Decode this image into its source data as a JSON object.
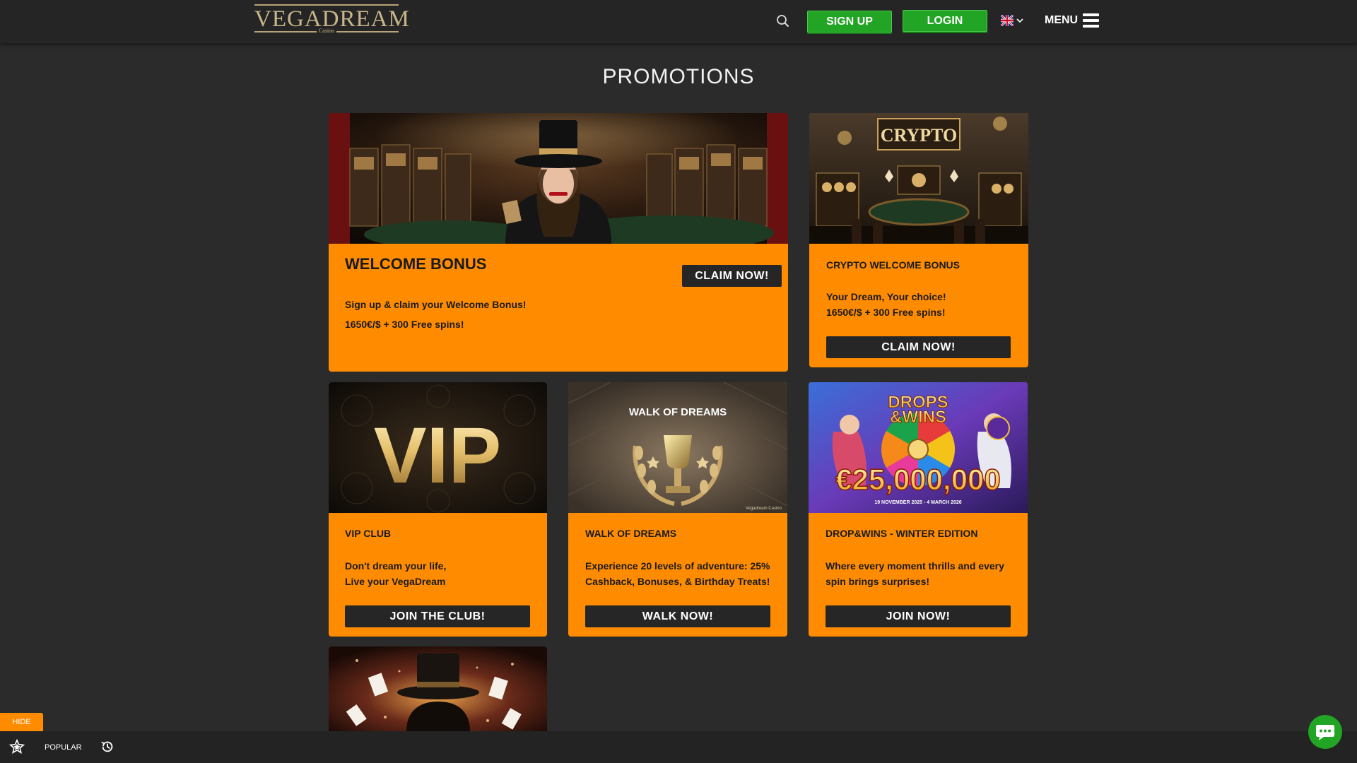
{
  "header": {
    "logo_text": "VEGADREAM",
    "logo_subtext": "Casino",
    "signup_label": "SIGN UP",
    "login_label": "LOGIN",
    "menu_label": "MENU"
  },
  "page_title": "PROMOTIONS",
  "promotions": [
    {
      "title": "WELCOME BONUS",
      "desc_line1": "Sign up & claim your Welcome Bonus!",
      "desc_line2": "1650€/$ + 300 Free spins!",
      "button": "CLAIM NOW!"
    },
    {
      "image_text": "CRYPTO",
      "title": "CRYPTO WELCOME BONUS",
      "desc_line1": "Your Dream, Your choice!",
      "desc_line2": "1650€/$ + 300 Free spins!",
      "button": "CLAIM NOW!"
    },
    {
      "image_text": "VIP",
      "title": "VIP CLUB",
      "desc_line1": "Don't dream your life,",
      "desc_line2": "Live your VegaDream",
      "button": "JOIN THE CLUB!"
    },
    {
      "image_text": "WALK OF DREAMS",
      "image_watermark": "Vegadream Casino",
      "title": "WALK OF DREAMS",
      "desc_line1": "Experience 20 levels of adventure: 25%",
      "desc_line2": "Cashback, Bonuses, & Birthday Treats!",
      "button": "WALK NOW!"
    },
    {
      "image_text_line1": "DROPS",
      "image_text_line2": "&WINS",
      "image_amount": "€25,000,000",
      "image_dates": "19 NOVEMBER 2025 - 4 MARCH 2026",
      "title": "DROP&WINS - WINTER EDITION",
      "desc_line1": "Where every moment thrills and every",
      "desc_line2": "spin brings surprises!",
      "button": "JOIN NOW!"
    }
  ],
  "bottom_bar": {
    "hide_label": "HIDE",
    "popular_label": "POPULAR"
  },
  "colors": {
    "accent_orange": "#ff8c00",
    "green": "#22a524",
    "dark": "#262626",
    "background": "#2b2b2b"
  },
  "icons": [
    "search-icon",
    "uk-flag-icon",
    "chevron-down-icon",
    "hamburger-icon",
    "star-icon",
    "history-icon",
    "chat-icon"
  ]
}
